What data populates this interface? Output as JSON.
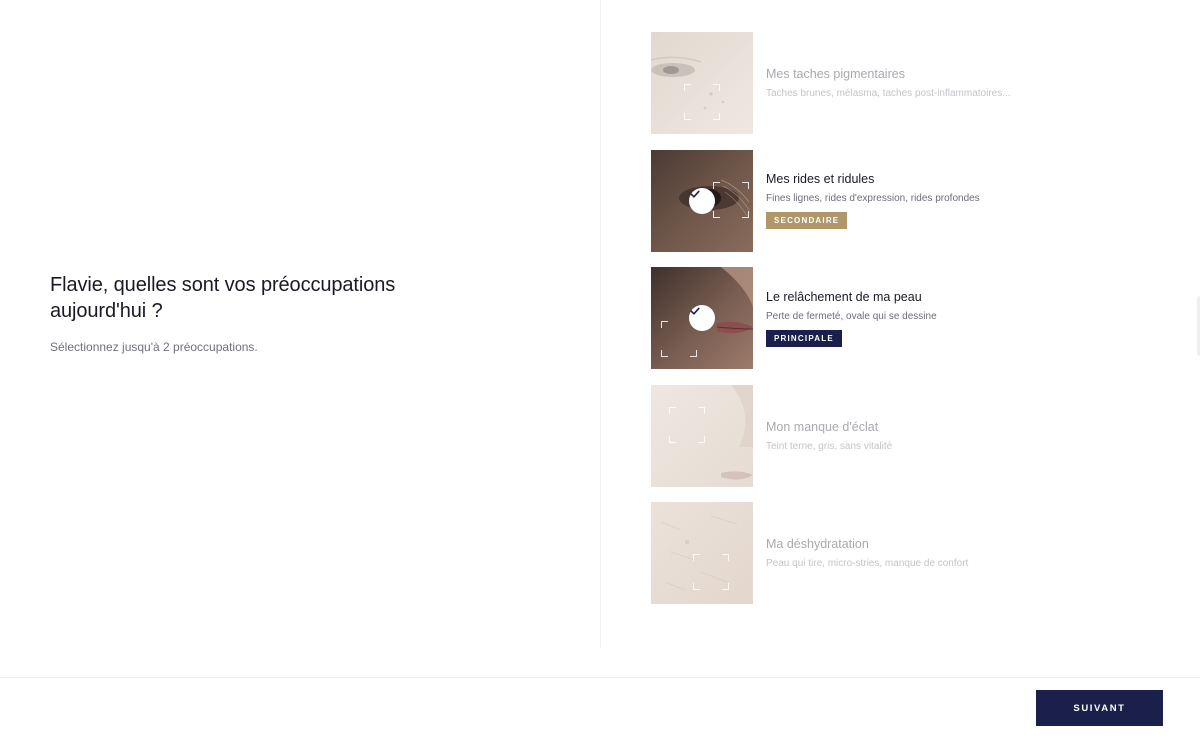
{
  "header": {
    "title": "Flavie, quelles sont vos préoccupations aujourd'hui ?",
    "subtitle": "Sélectionnez jusqu'à 2 préoccupations."
  },
  "options": [
    {
      "label": "Mes taches pigmentaires",
      "description": "Taches brunes, mélasma, taches post-inflammatoires...",
      "selected": false,
      "badge": "",
      "icon": "skin-pigment-image"
    },
    {
      "label": "Mes rides et ridules",
      "description": "Fines lignes, rides d'expression, rides profondes",
      "selected": true,
      "badge": "SECONDAIRE",
      "icon": "skin-wrinkles-image"
    },
    {
      "label": "Le relâchement de ma peau",
      "description": "Perte de fermeté, ovale qui se dessine",
      "selected": true,
      "badge": "PRINCIPALE",
      "icon": "skin-sagging-image"
    },
    {
      "label": "Mon manque d'éclat",
      "description": "Teint terne, gris, sans vitalité",
      "selected": false,
      "badge": "",
      "icon": "skin-radiance-image"
    },
    {
      "label": "Ma déshydratation",
      "description": "Peau qui tire, micro-stries, manque de confort",
      "selected": false,
      "badge": "",
      "icon": "skin-hydration-image"
    }
  ],
  "footer": {
    "next_label": "SUIVANT"
  },
  "colors": {
    "navy": "#1b1f4b",
    "gold": "#b0976a",
    "text_dark": "#1a1a26",
    "text_muted": "#707080"
  }
}
